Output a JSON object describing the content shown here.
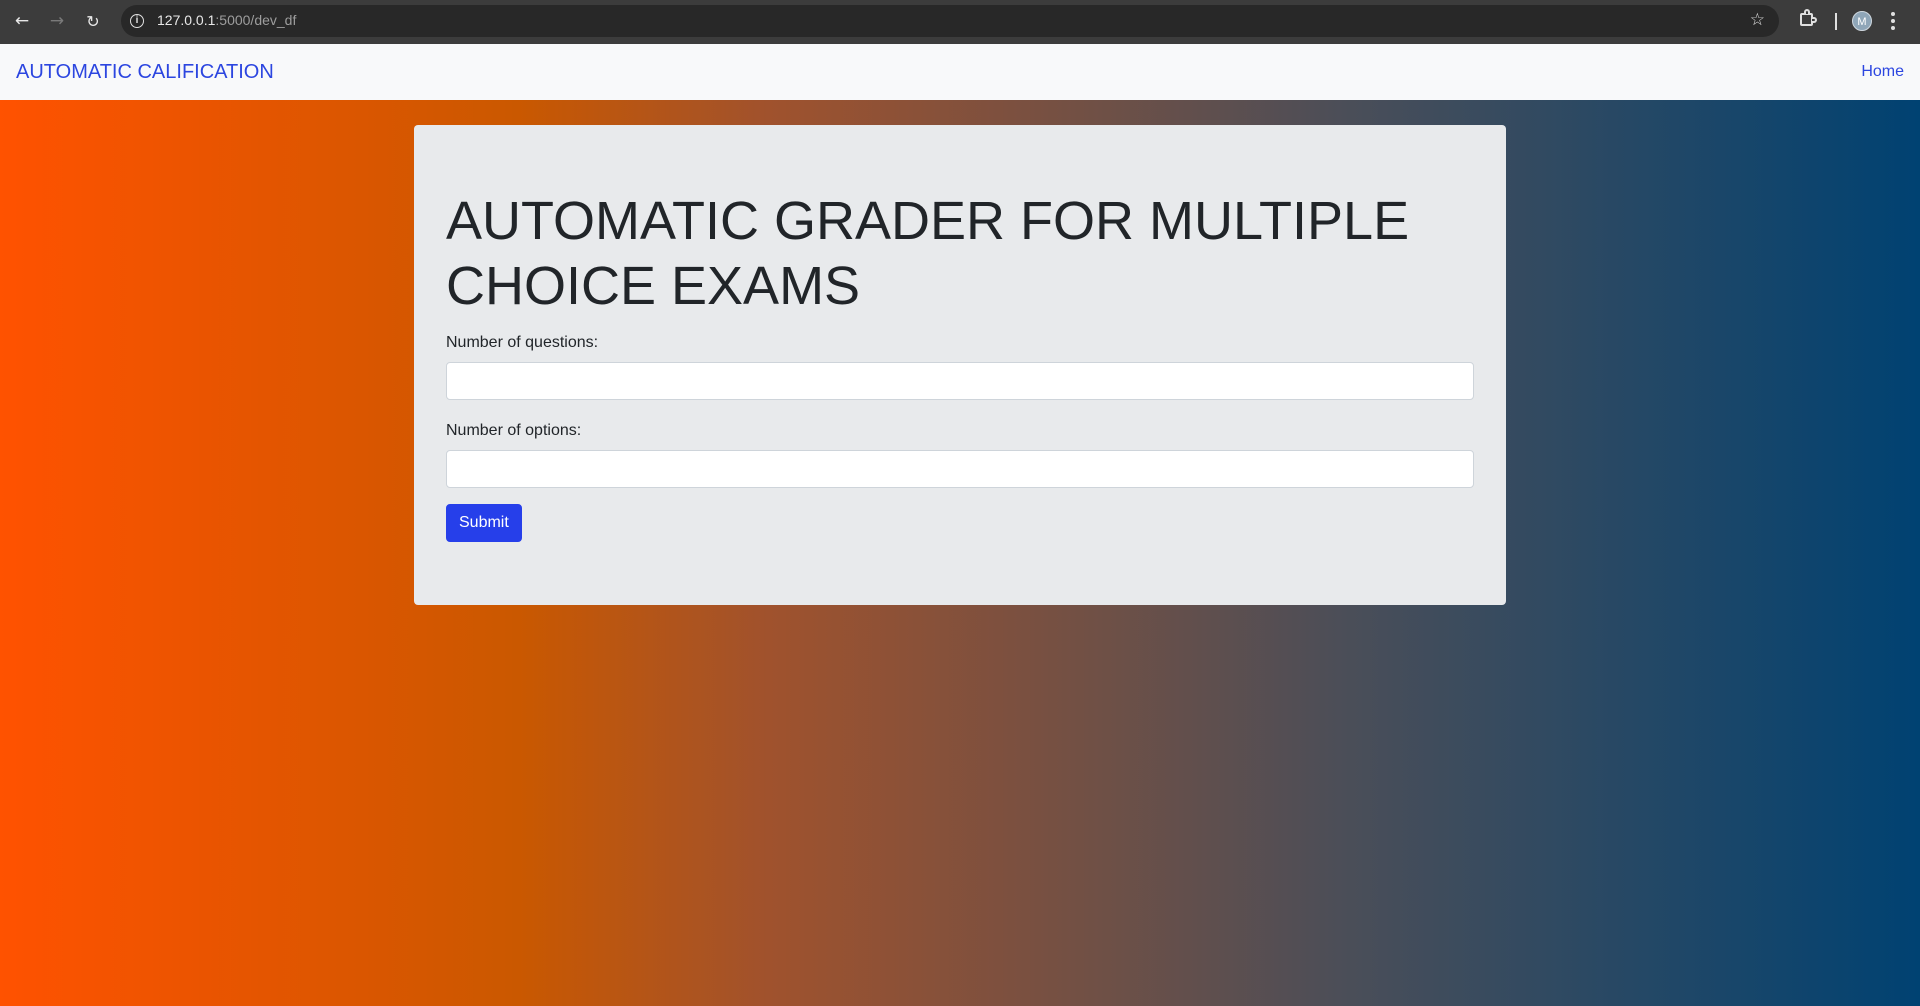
{
  "browser": {
    "url_host": "127.0.0.1",
    "url_path": ":5000/dev_df",
    "avatar_initial": "M",
    "icons": [
      "back-arrow-icon",
      "forward-arrow-icon",
      "reload-icon",
      "site-info-icon",
      "bookmark-star-icon",
      "extensions-icon",
      "profile-avatar",
      "kebab-menu-icon"
    ]
  },
  "navbar": {
    "brand": "AUTOMATIC CALIFICATION",
    "links": [
      {
        "label": "Home"
      }
    ]
  },
  "main": {
    "heading": "AUTOMATIC GRADER FOR MULTIPLE CHOICE EXAMS",
    "fields": [
      {
        "label": "Number of questions:",
        "value": ""
      },
      {
        "label": "Number of options:",
        "value": ""
      }
    ],
    "submit_label": "Submit"
  },
  "colors": {
    "accent": "#263fea",
    "brand_link": "#2c46e0",
    "gradient_start": "#ff5200",
    "gradient_end": "#004272",
    "card_bg": "#e8eaec"
  }
}
